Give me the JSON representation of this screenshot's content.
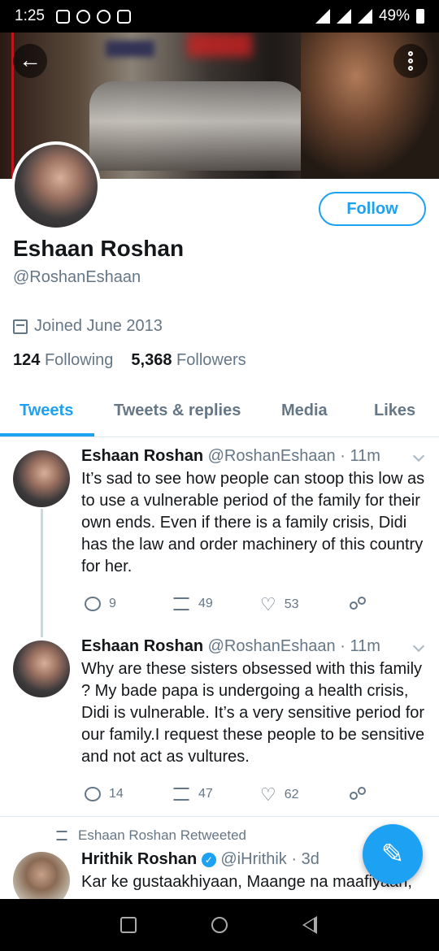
{
  "status_bar": {
    "time": "1:25",
    "battery": "49%"
  },
  "profile": {
    "name": "Eshaan Roshan",
    "handle": "@RoshanEshaan",
    "joined": "Joined June 2013",
    "following_count": "124",
    "following_label": "Following",
    "followers_count": "5,368",
    "followers_label": "Followers",
    "follow_button": "Follow"
  },
  "tabs": [
    {
      "label": "Tweets",
      "active": true
    },
    {
      "label": "Tweets & replies",
      "active": false
    },
    {
      "label": "Media",
      "active": false
    },
    {
      "label": "Likes",
      "active": false
    }
  ],
  "tweets": [
    {
      "name": "Eshaan Roshan",
      "meta": "@RoshanEshaan · 11m",
      "text": "It’s sad to see how people can stoop this low as to use a vulnerable period of the family for their own ends.  Even if there is a family crisis, Didi has the law and order machinery of this country for her.",
      "replies": "9",
      "retweets": "49",
      "likes": "53"
    },
    {
      "name": "Eshaan Roshan",
      "meta": "@RoshanEshaan · 11m",
      "text": "Why are these sisters obsessed with this family ? My bade papa is undergoing a health crisis, Didi is vulnerable. It’s a very sensitive period for our family.I request these people to be sensitive and not act as vultures.",
      "replies": "14",
      "retweets": "47",
      "likes": "62"
    },
    {
      "retweeted_by": "Eshaan Roshan Retweeted",
      "name": "Hrithik Roshan",
      "meta": "@iHrithik · 3d",
      "text": "Kar ke gustaakhiyaan, Maange na maafiyaan,"
    }
  ],
  "icons": {
    "back": "arrow-left-icon",
    "more": "more-vertical-icon",
    "compose": "compose-tweet-icon",
    "calendar": "calendar-icon"
  },
  "colors": {
    "accent": "#1da1f2",
    "muted": "#657786",
    "text": "#14171a"
  }
}
